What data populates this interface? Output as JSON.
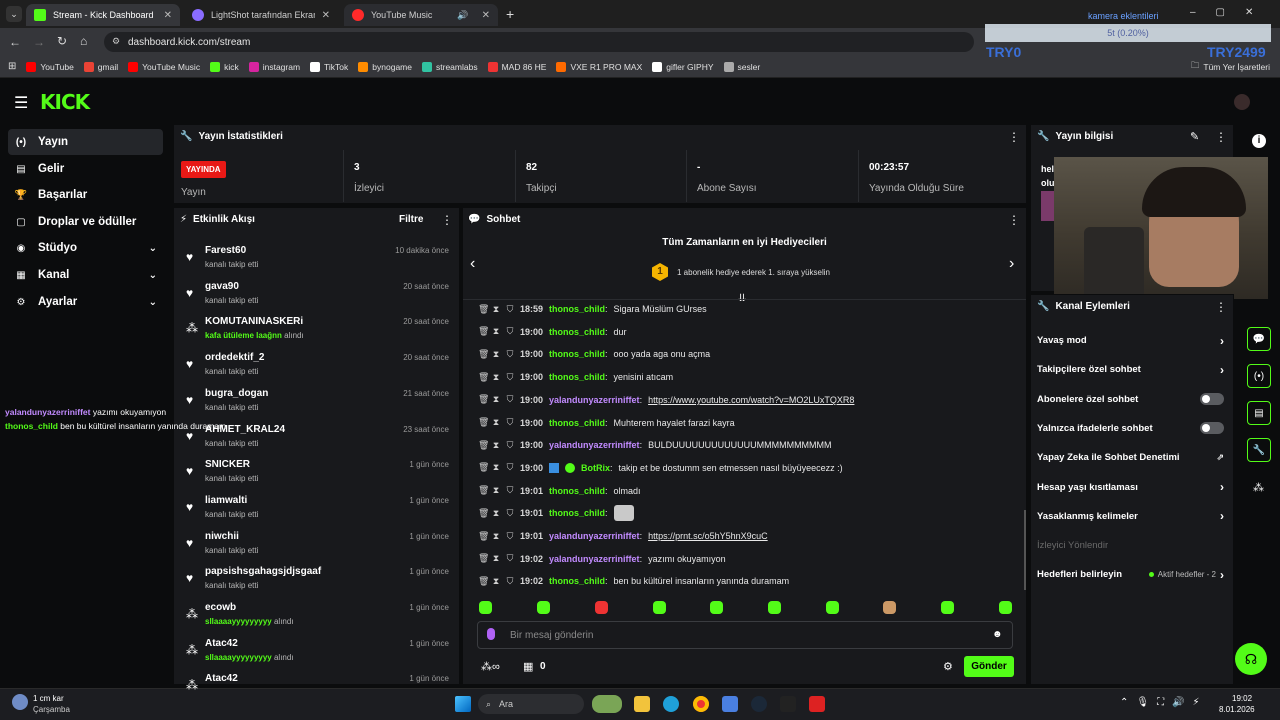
{
  "browser": {
    "tabs": [
      {
        "title": "Stream - Kick Dashboard",
        "color": "#53fc18"
      },
      {
        "title": "LightShot tarafından Ekran Görü",
        "color": "#8a6cff"
      },
      {
        "title": "YouTube Music",
        "color": "#ff2a2a"
      }
    ],
    "url": "dashboard.kick.com/stream",
    "bookmarks": [
      {
        "label": "YouTube",
        "color": "#ff0000"
      },
      {
        "label": "gmail",
        "color": "#ea4335"
      },
      {
        "label": "YouTube Music",
        "color": "#ff0000"
      },
      {
        "label": "kick",
        "color": "#53fc18"
      },
      {
        "label": "instagram",
        "color": "#d6249f"
      },
      {
        "label": "TikTok",
        "color": "#ffffff"
      },
      {
        "label": "bynogame",
        "color": "#ff8c00"
      },
      {
        "label": "streamlabs",
        "color": "#31c3a2"
      },
      {
        "label": "MAD 86 HE",
        "color": "#e33"
      },
      {
        "label": "VXE R1 PRO MAX",
        "color": "#ff6a00"
      },
      {
        "label": "gifler GIPHY",
        "color": "#ffffff"
      },
      {
        "label": "sesler",
        "color": "#aaaaaa"
      }
    ],
    "bookmarks_right": "Tüm Yer İşaretleri"
  },
  "overlay": {
    "title": "kamera eklentileri",
    "bar_text": "5t (0.20%)",
    "left_tag": "TRY0",
    "right_tag": "TRY2499",
    "chat_lines": [
      {
        "user": "yalandunyazerriniffet",
        "text": "yazımı okuyamıyon"
      },
      {
        "user": "thonos_child",
        "text": "ben bu kültürel insanların yanında duramam"
      }
    ]
  },
  "sidebar": {
    "items": [
      {
        "label": "Yayın",
        "icon": "(•)"
      },
      {
        "label": "Gelir",
        "icon": "▤"
      },
      {
        "label": "Başarılar",
        "icon": "🏆"
      },
      {
        "label": "Droplar ve ödüller",
        "icon": "▢"
      },
      {
        "label": "Stüdyo",
        "icon": "◉"
      },
      {
        "label": "Kanal",
        "icon": "▦"
      },
      {
        "label": "Ayarlar",
        "icon": "⚙"
      }
    ]
  },
  "stats": {
    "title": "Yayın İstatistikleri",
    "live_badge": "YAYINDA",
    "items": [
      {
        "value": "",
        "label": "Yayın"
      },
      {
        "value": "3",
        "label": "İzleyici"
      },
      {
        "value": "82",
        "label": "Takipçi"
      },
      {
        "value": "-",
        "label": "Abone Sayısı"
      },
      {
        "value": "00:23:57",
        "label": "Yayında Olduğu Süre"
      }
    ]
  },
  "activity": {
    "title": "Etkinlik Akışı",
    "filter": "Filtre",
    "items": [
      {
        "name": "Farest60",
        "sub": "kanalı takip etti",
        "time": "10 dakika önce",
        "type": "follow"
      },
      {
        "name": "gava90",
        "sub": "kanalı takip etti",
        "time": "20 saat önce",
        "type": "follow"
      },
      {
        "name": "KOMUTANINASKERi",
        "reward": "kafa ütüleme laağnn",
        "sub": "alındı",
        "time": "20 saat önce",
        "type": "reward"
      },
      {
        "name": "ordedektif_2",
        "sub": "kanalı takip etti",
        "time": "20 saat önce",
        "type": "follow"
      },
      {
        "name": "bugra_dogan",
        "sub": "kanalı takip etti",
        "time": "21 saat önce",
        "type": "follow"
      },
      {
        "name": "AHMET_KRAL24",
        "sub": "kanalı takip etti",
        "time": "23 saat önce",
        "type": "follow"
      },
      {
        "name": "SNICKER",
        "sub": "kanalı takip etti",
        "time": "1 gün önce",
        "type": "follow"
      },
      {
        "name": "liamwalti",
        "sub": "kanalı takip etti",
        "time": "1 gün önce",
        "type": "follow"
      },
      {
        "name": "niwchii",
        "sub": "kanalı takip etti",
        "time": "1 gün önce",
        "type": "follow"
      },
      {
        "name": "papsishsgahagsjdjsgaaf",
        "sub": "kanalı takip etti",
        "time": "1 gün önce",
        "type": "follow"
      },
      {
        "name": "ecowb",
        "reward": "sllaaaayyyyyyyyy",
        "sub": "alındı",
        "time": "1 gün önce",
        "type": "reward"
      },
      {
        "name": "Atac42",
        "reward": "sllaaaayyyyyyyyy",
        "sub": "alındı",
        "time": "1 gün önce",
        "type": "reward"
      },
      {
        "name": "Atac42",
        "sub": "",
        "time": "1 gün önce",
        "type": "reward"
      }
    ]
  },
  "chat": {
    "title": "Sohbet",
    "gifters_title": "Tüm Zamanların en iyi Hediyecileri",
    "gifters_rank": "1",
    "gifters_sub": "1 abonelik hediye ederek 1. sıraya yükselin",
    "messages": [
      {
        "time": "18:59",
        "user": "thonos_child",
        "color": "#53fc18",
        "text": "Sigara Müslüm GUrses"
      },
      {
        "time": "19:00",
        "user": "thonos_child",
        "color": "#53fc18",
        "text": "dur"
      },
      {
        "time": "19:00",
        "user": "thonos_child",
        "color": "#53fc18",
        "text": "ooo yada aga onu açma"
      },
      {
        "time": "19:00",
        "user": "thonos_child",
        "color": "#53fc18",
        "text": "yenisini atıcam"
      },
      {
        "time": "19:00",
        "user": "yalandunyazerriniffet",
        "color": "#c28bff",
        "text": "https://www.youtube.com/watch?v=MO2LUxTQXR8",
        "link": true
      },
      {
        "time": "19:00",
        "user": "thonos_child",
        "color": "#53fc18",
        "text": "Muhterem hayalet farazi kayra"
      },
      {
        "time": "19:00",
        "user": "yalandunyazerriniffet",
        "color": "#c28bff",
        "text": "BULDUUUUUUUUUUUUUMMMMMMMMMM"
      },
      {
        "time": "19:00",
        "user": "BotRix",
        "color": "#53fc18",
        "text": "takip et be dostumm sen etmessen nasıl büyüyeecezz :)",
        "bot": true
      },
      {
        "time": "19:01",
        "user": "thonos_child",
        "color": "#53fc18",
        "text": "olmadı"
      },
      {
        "time": "19:01",
        "user": "thonos_child",
        "color": "#53fc18",
        "text": "",
        "emote": true
      },
      {
        "time": "19:01",
        "user": "yalandunyazerriniffet",
        "color": "#c28bff",
        "text": "https://prnt.sc/o5hY5hnX9cuC",
        "link": true
      },
      {
        "time": "19:02",
        "user": "yalandunyazerriniffet",
        "color": "#c28bff",
        "text": "yazımı okuyamıyon"
      },
      {
        "time": "19:02",
        "user": "thonos_child",
        "color": "#53fc18",
        "text": "ben bu kültürel insanların yanında duramam"
      }
    ],
    "input_placeholder": "Bir mesaj gönderin",
    "points": "0",
    "send": "Gönder"
  },
  "stream_info": {
    "title": "Yayın bilgisi",
    "text": "hel\nolu"
  },
  "channel_actions": {
    "title": "Kanal Eylemleri",
    "items": [
      {
        "label": "Yavaş mod",
        "ctrl": "arrow"
      },
      {
        "label": "Takipçilere özel sohbet",
        "ctrl": "arrow"
      },
      {
        "label": "Abonelere özel sohbet",
        "ctrl": "toggle"
      },
      {
        "label": "Yalnızca ifadelerle sohbet",
        "ctrl": "toggle"
      },
      {
        "label": "Yapay Zeka ile Sohbet Denetimi",
        "ctrl": "ext"
      },
      {
        "label": "Hesap yaşı kısıtlaması",
        "ctrl": "arrow"
      },
      {
        "label": "Yasaklanmış kelimeler",
        "ctrl": "arrow"
      },
      {
        "label": "İzleyici Yönlendir",
        "ctrl": "none",
        "disabled": true
      },
      {
        "label": "Hedefleri belirleyin",
        "ctrl": "arrow",
        "extra": "Aktif hedefler - 2"
      }
    ]
  },
  "taskbar": {
    "weather": "1 cm kar",
    "weather_sub": "Çarşamba",
    "search": "Ara",
    "time": "19:02",
    "date": "8.01.2026"
  },
  "colors": {
    "accent": "#53fc18",
    "live": "#e91916",
    "panel": "#18191c",
    "bg": "#0b0c0d"
  }
}
